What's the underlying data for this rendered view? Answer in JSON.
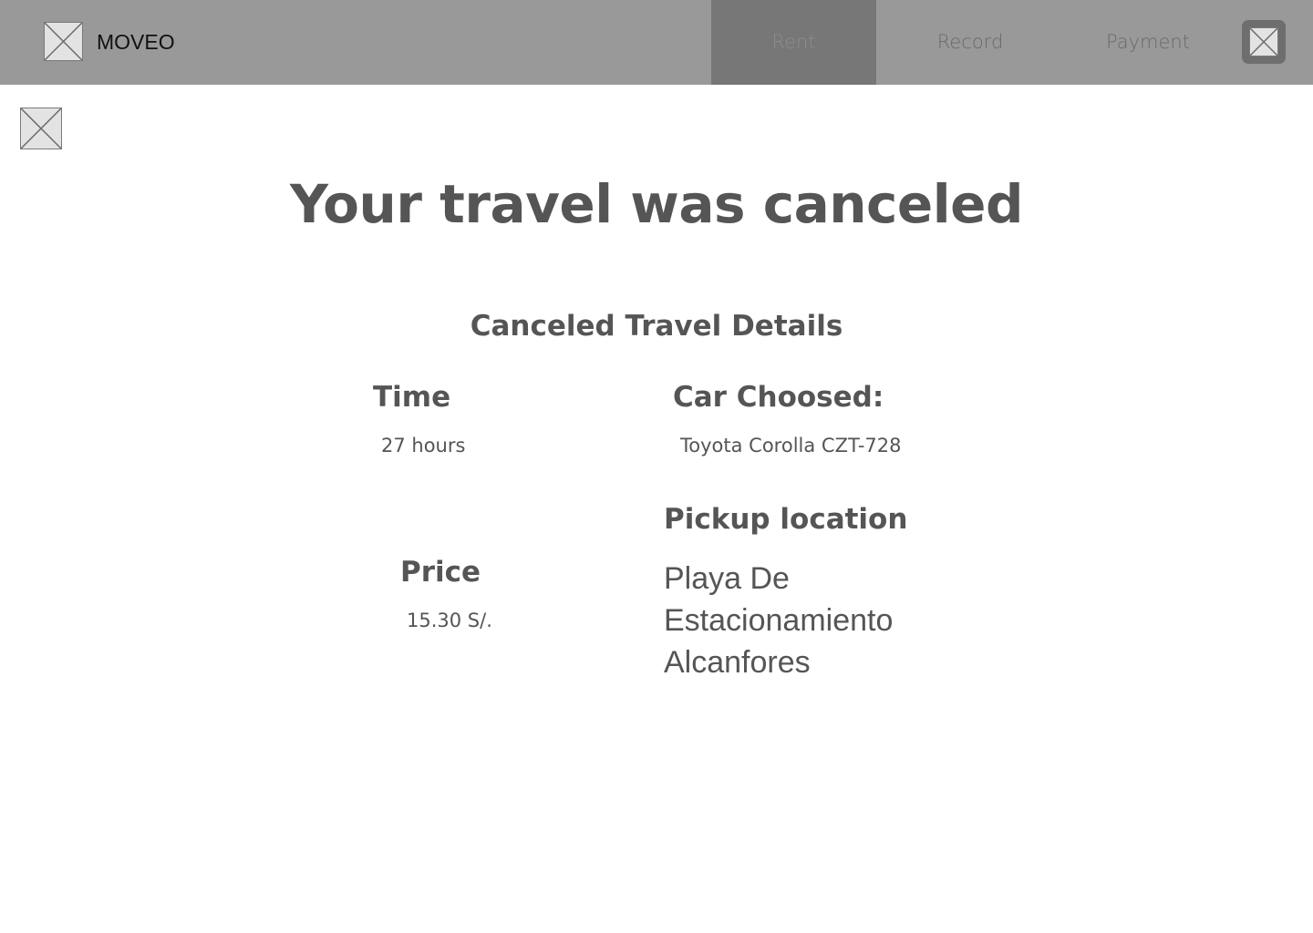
{
  "app": {
    "brand": "MOVEO",
    "logo_icon": "image-placeholder-icon"
  },
  "nav": {
    "items": [
      {
        "label": "Rent",
        "active": true
      },
      {
        "label": "Record",
        "active": false
      },
      {
        "label": "Payment",
        "active": false
      }
    ],
    "profile_icon": "image-placeholder-icon"
  },
  "page": {
    "back_icon": "image-placeholder-icon",
    "headline": "Your travel was canceled",
    "section_title": "Canceled Travel Details"
  },
  "details": {
    "time_label": "Time",
    "time_value": "27 hours",
    "car_label": "Car Choosed:",
    "car_value": "Toyota Corolla CZT-728",
    "pickup_label": "Pickup location",
    "pickup_value": "Playa De Estacionamiento Alcanfores",
    "price_label": "Price",
    "price_value": "15.30 S/."
  },
  "colors": {
    "topbar": "#999999",
    "active_tab": "#777777",
    "text": "#555555"
  }
}
